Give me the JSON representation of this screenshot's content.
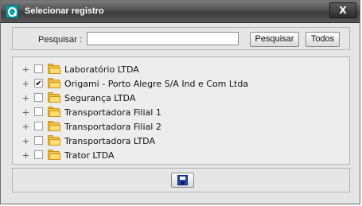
{
  "window": {
    "title": "Selecionar registro",
    "close_label": "X"
  },
  "search": {
    "label": "Pesquisar :",
    "value": "",
    "placeholder": "",
    "search_button": "Pesquisar",
    "all_button": "Todos"
  },
  "tree": {
    "items": [
      {
        "label": "Laboratório LTDA",
        "checked": false
      },
      {
        "label": "Origami - Porto Alegre S/A Ind e Com Ltda",
        "checked": true
      },
      {
        "label": "Segurança LTDA",
        "checked": false
      },
      {
        "label": "Transportadora Filial 1",
        "checked": false
      },
      {
        "label": "Transportadora Filial 2",
        "checked": false
      },
      {
        "label": "Transportadora LTDA",
        "checked": false
      },
      {
        "label": "Trator LTDA",
        "checked": false
      }
    ]
  },
  "footer": {
    "save_icon": "floppy-disk-icon"
  },
  "colors": {
    "titlebar": "#4d4d4d",
    "panel_bg": "#ededed",
    "folder": "#f2c344",
    "save_icon": "#2a45a8"
  }
}
